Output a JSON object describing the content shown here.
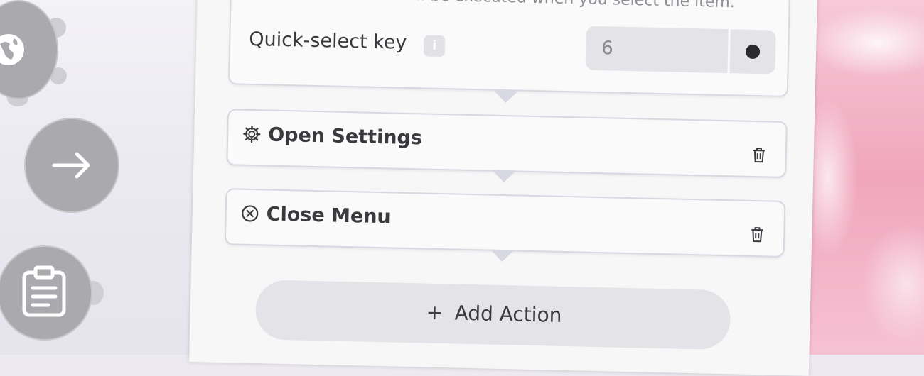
{
  "header": {
    "info_text": "The actions below will be executed when you select the item."
  },
  "quick_select": {
    "label": "Quick-select key",
    "info_badge": "i",
    "value": "6"
  },
  "actions": [
    {
      "title": "Open Settings",
      "icon": "gear-icon"
    },
    {
      "title": "Close Menu",
      "icon": "close-circle-icon"
    }
  ],
  "add_action": {
    "plus": "+",
    "label": "Add Action"
  },
  "left_nodes": [
    "globe-icon",
    "arrow-right-icon",
    "clipboard-icon"
  ],
  "colors": {
    "panel": "#f7f7f8",
    "card_border": "#d8d8e2",
    "node": "#a9a9ae",
    "pink_bg": "#f0a6bd"
  }
}
